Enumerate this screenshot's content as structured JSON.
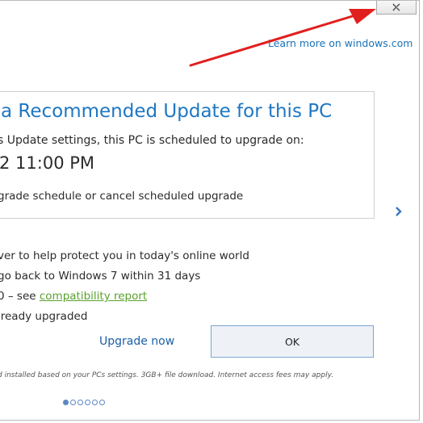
{
  "dialog": {
    "close_icon": "close-x-icon",
    "learn_more": "Learn more on windows.com",
    "card": {
      "title": "a Recommended Update for this PC",
      "line1": "s Update settings, this PC is scheduled to upgrade on:",
      "datetime": "2 11:00 PM",
      "line3": "grade schedule or cancel scheduled upgrade"
    },
    "next_icon": "chevron-right-icon",
    "bullets": [
      {
        "text": "ver to help protect you in today's online world"
      },
      {
        "text": "go back to Windows 7 within 31 days"
      },
      {
        "text": "0 – see ",
        "link": "compatibility report"
      },
      {
        "text": "lready upgraded"
      }
    ],
    "upgrade_now": "Upgrade now",
    "ok": "OK",
    "footnote": "d installed based on your PCs settings. 3GB+ file download. Internet access fees may apply.",
    "pagination": {
      "total": 6,
      "current": 1
    }
  },
  "annotation": {
    "arrow_color": "#e0201e"
  },
  "colors": {
    "accent_blue": "#1e77c3",
    "link_green": "#5aa12e"
  }
}
